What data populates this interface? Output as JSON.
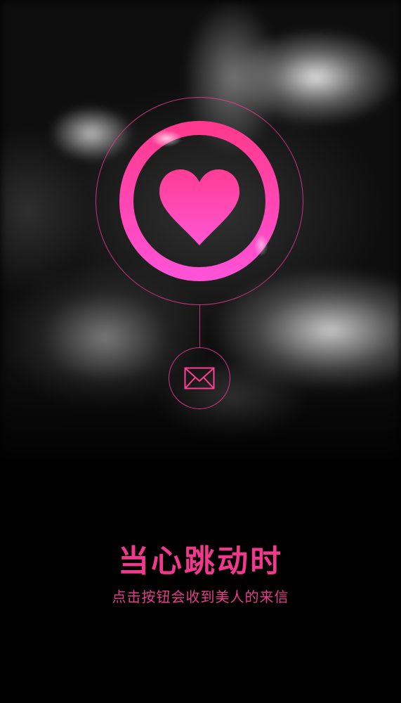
{
  "main": {
    "title": "当心跳动时",
    "subtitle": "点击按钮会收到美人的来信"
  },
  "icons": {
    "heart": "heart-icon",
    "mail": "envelope-icon"
  },
  "colors": {
    "accent": "#f0388c",
    "ring_start": "#ff3d8f",
    "ring_end": "#ff4fd2",
    "background": "#000000"
  }
}
